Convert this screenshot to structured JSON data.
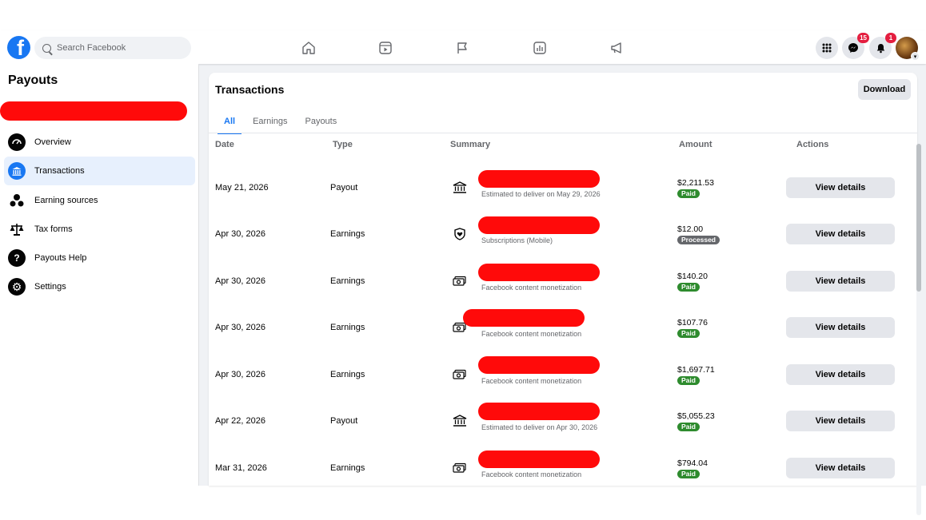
{
  "search": {
    "placeholder": "Search Facebook"
  },
  "topnav": {
    "icons": [
      "home-icon",
      "reels-icon",
      "pages-flag-icon",
      "insights-icon",
      "ads-megaphone-icon"
    ],
    "messenger_badge": "15",
    "notifications_badge": "1"
  },
  "sidebar": {
    "title": "Payouts",
    "items": [
      {
        "label": "Overview",
        "icon": "dashboard-icon",
        "active": false
      },
      {
        "label": "Transactions",
        "icon": "bank-icon",
        "active": true
      },
      {
        "label": "Earning sources",
        "icon": "earning-sources-icon",
        "active": false
      },
      {
        "label": "Tax forms",
        "icon": "scales-icon",
        "active": false
      },
      {
        "label": "Payouts Help",
        "icon": "help-icon",
        "active": false
      },
      {
        "label": "Settings",
        "icon": "gear-icon",
        "active": false
      }
    ]
  },
  "main": {
    "title": "Transactions",
    "download_label": "Download",
    "tabs": [
      "All",
      "Earnings",
      "Payouts"
    ],
    "columns": [
      "Date",
      "Type",
      "Summary",
      "Amount",
      "Actions"
    ],
    "rows": [
      {
        "date": "May 21, 2026",
        "type": "Payout",
        "icon": "bank-icon",
        "sub": "Estimated to deliver on May 29, 2026",
        "amount": "$2,211.53",
        "status": "Paid",
        "action": "View details"
      },
      {
        "date": "Apr 30, 2026",
        "type": "Earnings",
        "icon": "shield-heart-icon",
        "sub": "Subscriptions (Mobile)",
        "amount": "$12.00",
        "status": "Processed",
        "action": "View details"
      },
      {
        "date": "Apr 30, 2026",
        "type": "Earnings",
        "icon": "money-icon",
        "sub": "Facebook content monetization",
        "amount": "$140.20",
        "status": "Paid",
        "action": "View details"
      },
      {
        "date": "Apr 30, 2026",
        "type": "Earnings",
        "icon": "money-icon",
        "sub": "Facebook content monetization",
        "amount": "$107.76",
        "status": "Paid",
        "action": "View details"
      },
      {
        "date": "Apr 30, 2026",
        "type": "Earnings",
        "icon": "money-icon",
        "sub": "Facebook content monetization",
        "amount": "$1,697.71",
        "status": "Paid",
        "action": "View details"
      },
      {
        "date": "Apr 22, 2026",
        "type": "Payout",
        "icon": "bank-icon",
        "sub": "Estimated to deliver on Apr 30, 2026",
        "amount": "$5,055.23",
        "status": "Paid",
        "action": "View details"
      },
      {
        "date": "Mar 31, 2026",
        "type": "Earnings",
        "icon": "money-icon",
        "sub": "Facebook content monetization",
        "amount": "$794.04",
        "status": "Paid",
        "action": "View details"
      }
    ]
  },
  "colors": {
    "brand": "#1877f2",
    "paid": "#2e8b2e",
    "processed": "#65676b",
    "redaction": "#ff0a0a"
  }
}
